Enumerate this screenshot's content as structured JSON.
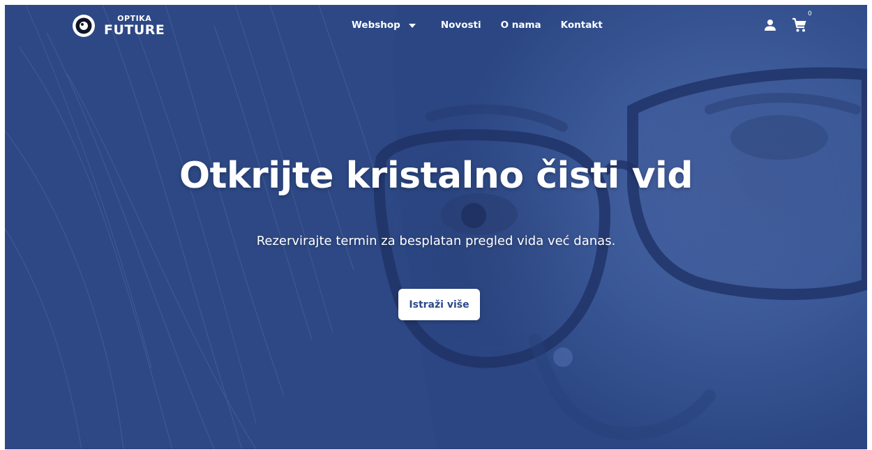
{
  "brand": {
    "top_text": "OPTIKA",
    "bottom_text": "FUTURE",
    "logo_icon": "eye-lens-icon"
  },
  "nav": {
    "items": [
      {
        "label": "Webshop",
        "has_dropdown": true
      },
      {
        "label": "Novosti"
      },
      {
        "label": "O nama"
      },
      {
        "label": "Kontakt"
      }
    ]
  },
  "header_icons": {
    "user_icon": "user-icon",
    "cart_icon": "cart-icon",
    "cart_count": "0"
  },
  "hero": {
    "title": "Otkrijte kristalno čisti vid",
    "subtitle": "Rezervirajte termin za besplatan pregled vida već danas.",
    "cta_label": "Istraži više"
  },
  "colors": {
    "hero_overlay": "#2e4a86",
    "cta_text": "#2b4a8a",
    "text": "#ffffff"
  }
}
